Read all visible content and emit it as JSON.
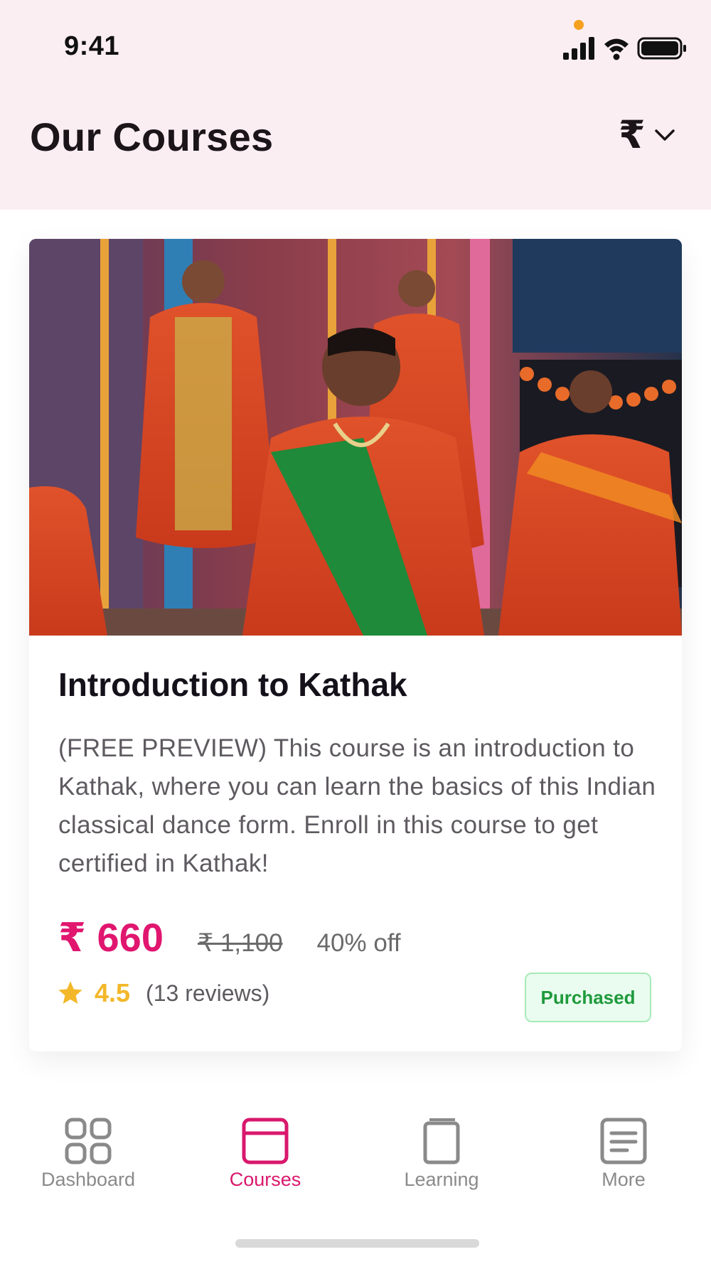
{
  "status_bar": {
    "time": "9:41"
  },
  "header": {
    "title": "Our Courses",
    "currency_symbol": "₹"
  },
  "course": {
    "title": "Introduction to Kathak",
    "description": "(FREE PREVIEW) This course is an introduction to Kathak, where you can learn the basics of this Indian classical dance form. Enroll in this course to get certified in Kathak!",
    "price": "₹ 660",
    "original_price": "₹ 1,100",
    "discount": "40% off",
    "rating": "4.5",
    "reviews": "(13 reviews)",
    "badge": "Purchased"
  },
  "bottom_nav": [
    {
      "label": "Dashboard",
      "icon": "grid-icon",
      "active": false
    },
    {
      "label": "Courses",
      "icon": "courses-icon",
      "active": true
    },
    {
      "label": "Learning",
      "icon": "book-icon",
      "active": false
    },
    {
      "label": "More",
      "icon": "list-icon",
      "active": false
    }
  ],
  "colors": {
    "accent": "#e0166f",
    "header_bg": "#fbeef2",
    "star": "#f3b72a",
    "badge_text": "#1f9a3c",
    "badge_bg": "#eafcef"
  }
}
